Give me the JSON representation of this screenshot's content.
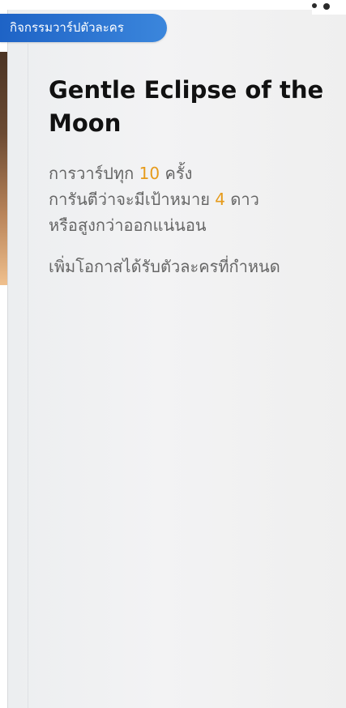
{
  "header": {
    "tag_label": "กิจกรรมวาร์ปตัวละคร"
  },
  "banner": {
    "title": "Gentle Eclipse of the Moon",
    "description_lines": [
      [
        "การวาร์ปทุก ",
        "10",
        " ครั้ง"
      ],
      [
        "การันตีว่าจะมีเป้าหมาย ",
        "4",
        " ดาว"
      ],
      [
        "หรือสูงกว่าออกแน่นอน"
      ]
    ],
    "extra_line": "เพิ่มโอกาสได้รับตัวละครที่กำหนด"
  },
  "colors": {
    "tag": "#2f77c8",
    "highlight": "#e69b1b",
    "title": "#111111",
    "text": "#666666"
  }
}
